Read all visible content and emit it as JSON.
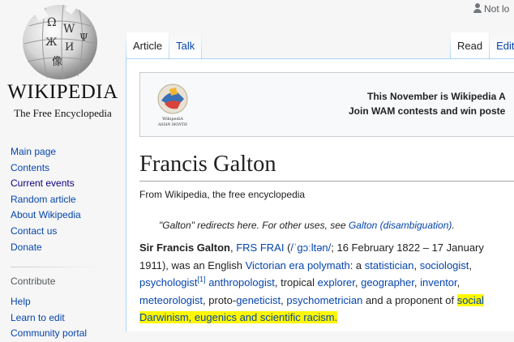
{
  "personal": {
    "label": "Not lo"
  },
  "logo": {
    "wordmark": "WIKIPEDIA",
    "tagline": "The Free Encyclopedia",
    "glyphs": [
      "Ω",
      "W",
      "Ж",
      "И",
      "Ψ",
      "像"
    ]
  },
  "navigation": {
    "items": [
      "Main page",
      "Contents",
      "Current events",
      "Random article",
      "About Wikipedia",
      "Contact us",
      "Donate"
    ]
  },
  "contribute": {
    "heading": "Contribute",
    "items": [
      "Help",
      "Learn to edit",
      "Community portal"
    ]
  },
  "tabs": {
    "article": "Article",
    "talk": "Talk",
    "read": "Read",
    "edit": "Edit"
  },
  "banner": {
    "logo_text_1": "WikipediA",
    "logo_text_2": "ASIAN MONTH",
    "line1": "This November is Wikipedia A",
    "line2": "Join WAM contests and win poste"
  },
  "article": {
    "title": "Francis Galton",
    "subtitle": "From Wikipedia, the free encyclopedia",
    "hatnote": {
      "text": "\"Galton\" redirects here. For other uses, see ",
      "link": "Galton (disambiguation)",
      "end": "."
    },
    "intro": {
      "name": "Sir Francis Galton",
      "postnominals": "FRS FRAI",
      "pron_open": " (",
      "ipa": "/ˈɡɔːltən/",
      "pron_close": "; 16 February 1822 – 17 January 1911), was an English ",
      "link1": "Victorian era",
      "link2": "polymath",
      "t1": ": a ",
      "link3": "statistician",
      "link4": "sociologist",
      "link5": "psychologist",
      "ref": "[1]",
      "link6": "anthropologist",
      "t2": ", tropical ",
      "link7": "explorer",
      "link8": "geographer",
      "link9": "inventor",
      "link10": "meteorologist",
      "t3": ", proto-",
      "link11": "geneticist",
      "link12": "psychometrician",
      "t4": " and a proponent of ",
      "link13": "social Darwinism",
      "link14": "eugenics",
      "t5": " and ",
      "link15": "scientific racism",
      "end": "."
    }
  },
  "colors": {
    "link": "#0645ad",
    "highlight": "#fff700",
    "tab_border": "#a7d7f9"
  }
}
